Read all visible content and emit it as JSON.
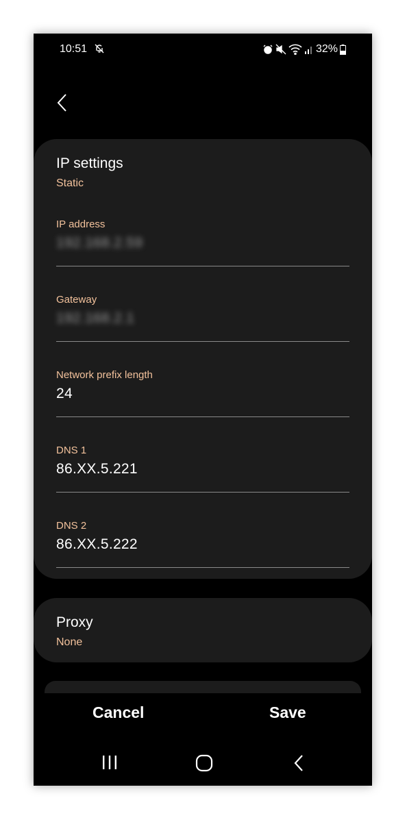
{
  "status_bar": {
    "time": "10:51",
    "battery": "32%",
    "icons": [
      "notifications-off-icon",
      "alarm-icon",
      "mute-icon",
      "wifi-icon",
      "signal-icon",
      "battery-icon"
    ]
  },
  "ip_settings": {
    "title": "IP settings",
    "mode": "Static",
    "fields": [
      {
        "label": "IP address",
        "value": "192.168.2.59",
        "obscured": true
      },
      {
        "label": "Gateway",
        "value": "192.168.2.1",
        "obscured": true
      },
      {
        "label": "Network prefix length",
        "value": "24",
        "obscured": false
      },
      {
        "label": "DNS 1",
        "value": "86.XX.5.221",
        "obscured": false
      },
      {
        "label": "DNS 2",
        "value": "86.XX.5.222",
        "obscured": false
      }
    ]
  },
  "proxy": {
    "title": "Proxy",
    "value": "None"
  },
  "actions": {
    "cancel": "Cancel",
    "save": "Save"
  },
  "colors": {
    "background": "#000000",
    "card": "#1c1c1c",
    "accent_label": "#f3c29c",
    "text": "#ffffff",
    "divider": "#8a8a8a"
  }
}
